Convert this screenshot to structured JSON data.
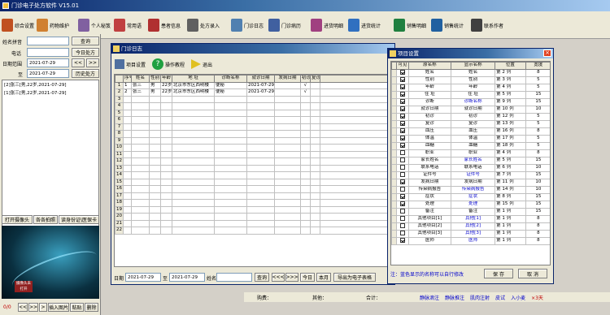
{
  "app": {
    "title": "门诊电子处方软件  V15.01"
  },
  "toolbar": {
    "items": [
      {
        "label": "综合设置",
        "icon": "settings-icon",
        "color": "#c05020"
      },
      {
        "label": "药物维护",
        "icon": "pill-icon",
        "color": "#d08030"
      },
      {
        "label": "个人秘笈",
        "icon": "book-icon",
        "color": "#8060a0"
      },
      {
        "label": "常用语",
        "icon": "chat-icon",
        "color": "#c04040"
      },
      {
        "label": "患者信息",
        "icon": "patient-icon",
        "color": "#b03030"
      },
      {
        "label": "处方录入",
        "icon": "scissors-icon",
        "color": "#606060"
      },
      {
        "label": "门诊日志",
        "icon": "log-icon",
        "color": "#5080b0"
      },
      {
        "label": "门诊病历",
        "icon": "record-icon",
        "color": "#4060a0"
      },
      {
        "label": "进货明细",
        "icon": "chart-icon",
        "color": "#a04080"
      },
      {
        "label": "进货统计",
        "icon": "stats-icon",
        "color": "#3070c0"
      },
      {
        "label": "销售明细",
        "icon": "sales-icon",
        "color": "#208040"
      },
      {
        "label": "销售统计",
        "icon": "sales-stats-icon",
        "color": "#2060a0"
      },
      {
        "label": "联系作者",
        "icon": "contact-icon",
        "color": "#404040"
      }
    ]
  },
  "left": {
    "name_label": "姓名拼音",
    "query": "查询",
    "phone_label": "电话",
    "today_prescription": "今日处方",
    "date_range_label": "日期范围",
    "date_from": "2021-07-29",
    "to_label": "至",
    "date_to": "2021-07-29",
    "history": "历史处方",
    "list": [
      "[2]张三[男,22岁,2021-07-29]",
      "[1]张三[男,22岁,2021-07-29]"
    ],
    "camera_open": "打开摄像头",
    "capture": "各各拍照",
    "read_id": "读身份证\\医保卡",
    "page_counter": "0/0",
    "insert_photo": "插入图片",
    "paste": "粘贴",
    "delete": "删除",
    "preview_caption": "摄像头未打开"
  },
  "log_window": {
    "title": "门诊日志",
    "toolbar": [
      "项目设置",
      "操作教程",
      "退出"
    ],
    "columns": [
      "序号",
      "姓名",
      "性别",
      "年龄",
      "地  址",
      "诊断名称",
      "就诊日期",
      "发病日期",
      "初诊",
      "复诊"
    ],
    "rows": [
      [
        "1",
        "张三",
        "男",
        "22岁",
        "北京市东区西明楼",
        "便秘",
        "2021-07-29",
        "",
        "√",
        ""
      ],
      [
        "2",
        "张三",
        "男",
        "22岁",
        "北京市东区西明楼",
        "便秘",
        "2021-07-29",
        "",
        "√",
        ""
      ]
    ],
    "row_numbers": [
      "1",
      "2",
      "3",
      "4",
      "5",
      "6",
      "7",
      "8",
      "9",
      "10",
      "11",
      "12",
      "13",
      "14",
      "15",
      "16",
      "17",
      "18",
      "19",
      "20",
      "21",
      "22"
    ],
    "footer": {
      "date_label": "日期",
      "date_from": "2021-07-29",
      "to_label": "至",
      "date_to": "2021-07-29",
      "name_label": "姓名",
      "query": "查询",
      "prev_prev": "<<<",
      "next_next": ">>>",
      "today": "今日",
      "month": "本月",
      "export": "导出为电子表格"
    }
  },
  "settings_window": {
    "title": "项目设置",
    "columns": [
      "可见",
      "原名称",
      "显示名称",
      "位置",
      "宽度"
    ],
    "rows": [
      {
        "v": true,
        "orig": "姓名",
        "disp": "姓名",
        "pos": "第 2 列",
        "w": "8",
        "blue": false
      },
      {
        "v": true,
        "orig": "性别",
        "disp": "性别",
        "pos": "第 3 列",
        "w": "5",
        "blue": false
      },
      {
        "v": true,
        "orig": "年龄",
        "disp": "年龄",
        "pos": "第 4 列",
        "w": "5",
        "blue": false
      },
      {
        "v": true,
        "orig": "住  址",
        "disp": "住  址",
        "pos": "第 5 列",
        "w": "15",
        "blue": false
      },
      {
        "v": true,
        "orig": "诊断",
        "disp": "诊断名称",
        "pos": "第 9 列",
        "w": "15",
        "blue": true
      },
      {
        "v": true,
        "orig": "就诊日期",
        "disp": "就诊日期",
        "pos": "第 10 列",
        "w": "10",
        "blue": false
      },
      {
        "v": true,
        "orig": "初诊",
        "disp": "初诊",
        "pos": "第 12 列",
        "w": "5",
        "blue": false
      },
      {
        "v": true,
        "orig": "复诊",
        "disp": "复诊",
        "pos": "第 13 列",
        "w": "5",
        "blue": false
      },
      {
        "v": true,
        "orig": "血压",
        "disp": "血压",
        "pos": "第 16 列",
        "w": "8",
        "blue": false
      },
      {
        "v": true,
        "orig": "体温",
        "disp": "体温",
        "pos": "第 17 列",
        "w": "5",
        "blue": false
      },
      {
        "v": true,
        "orig": "血糖",
        "disp": "血糖",
        "pos": "第 18 列",
        "w": "5",
        "blue": false
      },
      {
        "v": false,
        "orig": "职业",
        "disp": "职业",
        "pos": "第 4 列",
        "w": "8",
        "blue": false
      },
      {
        "v": false,
        "orig": "家长姓名",
        "disp": "家长姓名",
        "pos": "第 5 列",
        "w": "15",
        "blue": true
      },
      {
        "v": false,
        "orig": "联系电话",
        "disp": "联系电话",
        "pos": "第 6 列",
        "w": "10",
        "blue": false
      },
      {
        "v": false,
        "orig": "证件号",
        "disp": "证件号",
        "pos": "第 7 列",
        "w": "15",
        "blue": true
      },
      {
        "v": true,
        "orig": "发病日期",
        "disp": "发病日期",
        "pos": "第 11 列",
        "w": "10",
        "blue": false
      },
      {
        "v": false,
        "orig": "传染病报告",
        "disp": "传染病报告",
        "pos": "第 14 列",
        "w": "10",
        "blue": true
      },
      {
        "v": true,
        "orig": "症状",
        "disp": "症状",
        "pos": "第 8 列",
        "w": "15",
        "blue": true
      },
      {
        "v": true,
        "orig": "处理",
        "disp": "处理",
        "pos": "第 15 列",
        "w": "15",
        "blue": true
      },
      {
        "v": false,
        "orig": "备注",
        "disp": "备注",
        "pos": "第 1 列",
        "w": "15",
        "blue": false
      },
      {
        "v": false,
        "orig": "其他项目[1]",
        "disp": "其他[1]",
        "pos": "第 1 列",
        "w": "8",
        "blue": true
      },
      {
        "v": false,
        "orig": "其他项目[2]",
        "disp": "其他[2]",
        "pos": "第 1 列",
        "w": "8",
        "blue": true
      },
      {
        "v": false,
        "orig": "其他项目[3]",
        "disp": "其他[3]",
        "pos": "第 1 列",
        "w": "8",
        "blue": true
      },
      {
        "v": true,
        "orig": "医师",
        "disp": "医师",
        "pos": "第 1 列",
        "w": "8",
        "blue": true
      }
    ],
    "note": "注：蓝色显示的名称可以自行修改",
    "save": "保 存",
    "cancel": "取 消"
  },
  "status": {
    "amount_label": "购费：",
    "other_label": "其他：",
    "total_label": "合计：",
    "links": [
      "静脉滴注",
      "静脉推注",
      "肌肉注射",
      "皮试",
      "入小麦"
    ],
    "days": "×3天"
  }
}
